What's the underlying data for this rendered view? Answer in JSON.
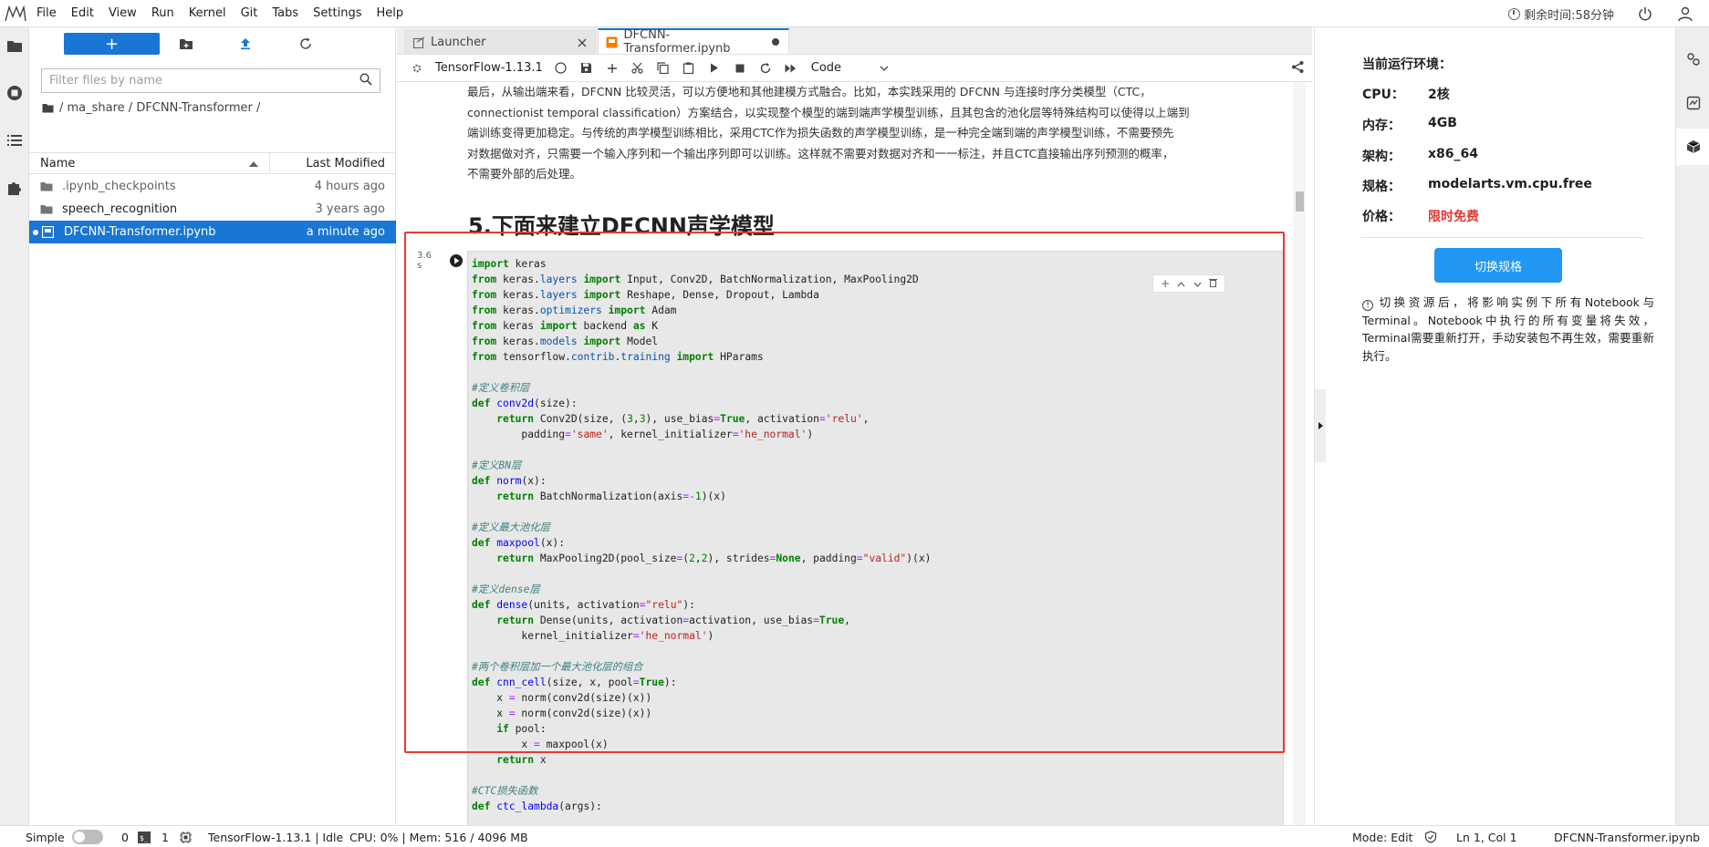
{
  "menubar": {
    "items": [
      "File",
      "Edit",
      "View",
      "Run",
      "Kernel",
      "Git",
      "Tabs",
      "Settings",
      "Help"
    ],
    "timer_label": "剩余时间:58分钟"
  },
  "filebrowser": {
    "new_label": "+",
    "search_placeholder": "Filter files by name",
    "breadcrumb": "/ ma_share / DFCNN-Transformer /",
    "col_name": "Name",
    "col_modified": "Last Modified",
    "files": [
      {
        "name": ".ipynb_checkpoints",
        "modified": "4 hours ago"
      },
      {
        "name": "speech_recognition",
        "modified": "3 years ago"
      },
      {
        "name": "DFCNN-Transformer.ipynb",
        "modified": "a minute ago"
      }
    ]
  },
  "tabs": [
    {
      "label": "Launcher"
    },
    {
      "label": "DFCNN-Transformer.ipynb"
    }
  ],
  "notebook": {
    "kernel": "TensorFlow-1.13.1",
    "cell_type": "Code",
    "markdown_lines": [
      "最后，从输出端来看，DFCNN 比较灵活，可以方便地和其他建模方式融合。比如，本实践采用的 DFCNN 与连接时序分类模型（CTC，",
      "connectionist temporal classification）方案结合，以实现整个模型的端到端声学模型训练，且其包含的池化层等特殊结构可以使得以上端到",
      "端训练变得更加稳定。与传统的声学模型训练相比，采用CTC作为损失函数的声学模型训练，是一种完全端到端的声学模型训练，不需要预先",
      "对数据做对齐，只需要一个输入序列和一个输出序列即可以训练。这样就不需要对数据对齐和一一标注，并且CTC直接输出序列预测的概率，",
      "不需要外部的后处理。"
    ],
    "heading": "5.下面来建立DFCNN声学模型",
    "prompt": "3.6\ns"
  },
  "env": {
    "title": "当前运行环境：",
    "rows": [
      {
        "label": "CPU：",
        "value": "2核"
      },
      {
        "label": "内存：",
        "value": "4GB"
      },
      {
        "label": "架构：",
        "value": "x86_64"
      },
      {
        "label": "规格：",
        "value": "modelarts.vm.cpu.free"
      },
      {
        "label": "价格：",
        "value": "限时免费"
      }
    ],
    "switch_label": "切换规格",
    "notice": "切换资源后，将影响实例下所有Notebook与Terminal。Notebook中执行的所有变量将失效，Terminal需要重新打开，手动安装包不再生效，需要重新执行。"
  },
  "statusbar": {
    "simple": "Simple",
    "count_a": "0",
    "count_b": "1",
    "kernel_status": "TensorFlow-1.13.1 | Idle",
    "resources": "CPU: 0% | Mem: 516 / 4096 MB",
    "mode": "Mode: Edit",
    "position": "Ln 1, Col 1",
    "filename": "DFCNN-Transformer.ipynb"
  }
}
